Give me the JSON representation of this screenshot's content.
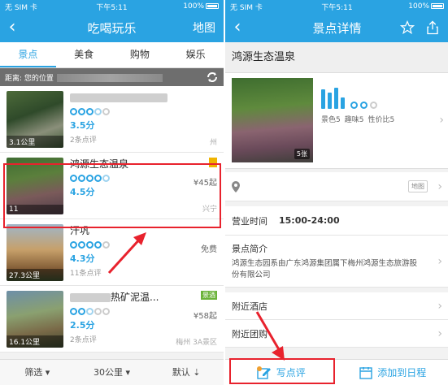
{
  "colors": {
    "brand": "#2aa3e2",
    "highlight": "#e8222d"
  },
  "left": {
    "status": {
      "carrier": "无 SIM 卡",
      "time": "下午5:11",
      "battery": "100%"
    },
    "nav": {
      "title": "吃喝玩乐",
      "right_action": "地图"
    },
    "tabs": [
      "景点",
      "美食",
      "购物",
      "娱乐"
    ],
    "distance_label": "距离: 您的位置",
    "items": [
      {
        "name": "",
        "score": "3.5分",
        "reviews": "2条点评",
        "distance": "3.1公里",
        "price": "",
        "region": "州",
        "badge": ""
      },
      {
        "name": "鸿源生态温泉",
        "score": "4.5分",
        "reviews": "",
        "distance": "11",
        "price": "¥45起",
        "region": "兴宁",
        "badge": ""
      },
      {
        "name": "汗巩",
        "score": "4.3分",
        "reviews": "11条点评",
        "distance": "27.3公里",
        "price": "免费",
        "region": "",
        "badge": ""
      },
      {
        "name": "热矿泥温...",
        "score": "2.5分",
        "reviews": "2条点评",
        "distance": "16.1公里",
        "price": "¥58起",
        "region": "梅州 3A景区",
        "badge": "景酒"
      }
    ],
    "bottom": {
      "filter": "筛选",
      "distance": "30公里",
      "sort": "默认"
    }
  },
  "right": {
    "status": {
      "carrier": "无 SIM 卡",
      "time": "下午5:11",
      "battery": "100%"
    },
    "nav": {
      "title": "景点详情"
    },
    "poi_name": "鸿源生态温泉",
    "photo_count": "5张",
    "subscores": [
      "景色5",
      "趣味5",
      "性价比5"
    ],
    "map_button": "地图",
    "hours_label": "营业时间",
    "hours_value": "15:00-24:00",
    "intro_label": "景点简介",
    "intro_text": "鸿源生态园系由广东鸿源集团属下梅州鸿源生态旅游股份有限公司",
    "nearby_hotels": "附近酒店",
    "nearby_groupbuy": "附近团购",
    "write_review": "写点评",
    "add_schedule": "添加到日程"
  }
}
